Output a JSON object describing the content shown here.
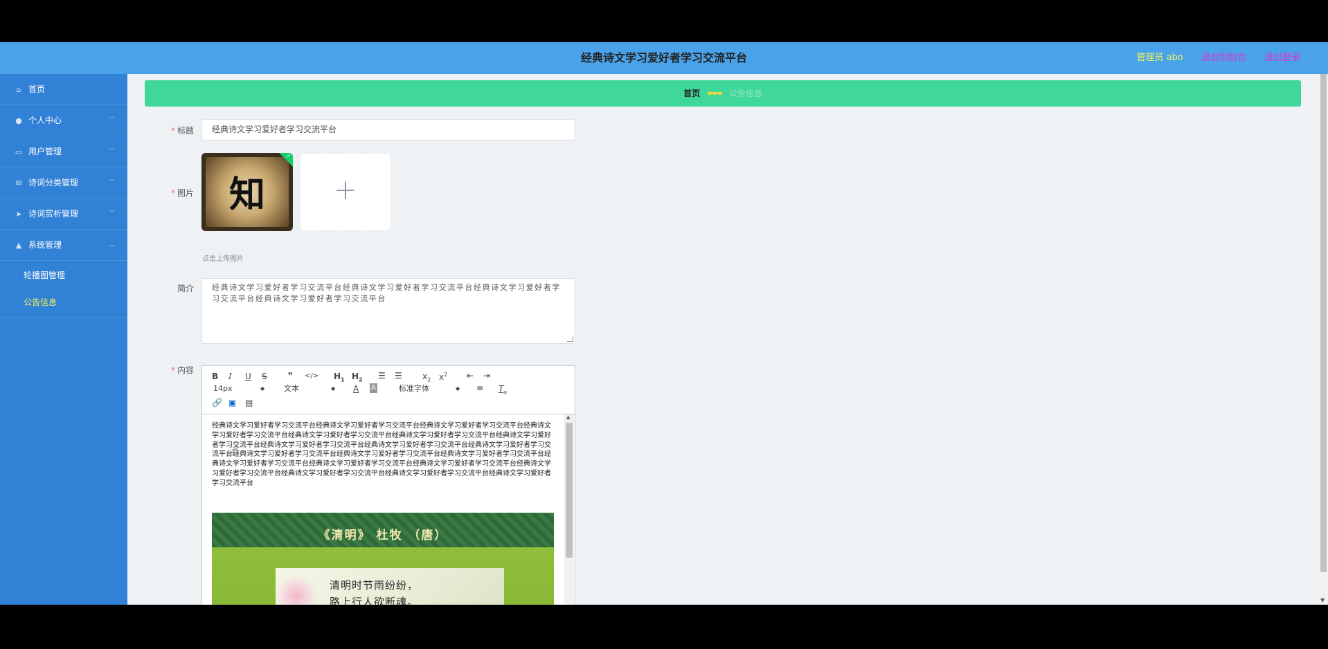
{
  "header": {
    "site_title": "经典诗文学习爱好者学习交流平台",
    "user_label": "管理员 abo",
    "back_to_front": "退出到前台",
    "logout": "退出登录"
  },
  "sidebar": {
    "items": [
      {
        "label": "首页",
        "icon": "home-icon"
      },
      {
        "label": "个人中心",
        "icon": "user-icon"
      },
      {
        "label": "用户管理",
        "icon": "id-card-icon"
      },
      {
        "label": "诗词分类管理",
        "icon": "mail-icon"
      },
      {
        "label": "诗词赏析管理",
        "icon": "send-icon"
      },
      {
        "label": "系统管理",
        "icon": "thumb-up-icon"
      }
    ],
    "sub_items": [
      {
        "label": "轮播图管理",
        "active": false
      },
      {
        "label": "公告信息",
        "active": true
      }
    ]
  },
  "breadcrumb": {
    "home": "首页",
    "separator": "❤❤❤",
    "current": "公告信息"
  },
  "form": {
    "title_label": "标题",
    "title_value": "经典诗文学习爱好者学习交流平台",
    "image_label": "图片",
    "image_char": "知",
    "upload_tip": "点击上传图片",
    "intro_label": "简介",
    "intro_value": "经典诗文学习爱好者学习交流平台经典诗文学习爱好者学习交流平台经典诗文学习爱好者学习交流平台经典诗文学习爱好者学习交流平台",
    "content_label": "内容"
  },
  "editor": {
    "font_size": "14px",
    "header_select": "文本",
    "font_family": "标准字体",
    "body_text": "经典诗文学习爱好者学习交流平台经典诗文学习爱好者学习交流平台经典诗文学习爱好者学习交流平台经典诗文学习爱好者学习交流平台经典诗文学习爱好者学习交流平台经典诗文学习爱好者学习交流平台经典诗文学习爱好者学习交流平台经典诗文学习爱好者学习交流平台经典诗文学习爱好者学习交流平台经典诗文学习爱好者学习交流平台经典诗文学习爱好者学习交流平台经典诗文学习爱好者学习交流平台经典诗文学习爱好者学习交流平台经典诗文学习爱好者学习交流平台经典诗文学习爱好者学习交流平台经典诗文学习爱好者学习交流平台经典诗文学习爱好者学习交流平台经典诗文学习爱好者学习交流平台经典诗文学习爱好者学习交流平台经典诗文学习爱好者学习交流平台",
    "poem_title": "《清明》  杜牧  （唐）",
    "poem_line1": "清明时节雨纷纷，",
    "poem_line2": "路上行人欲断魂。"
  },
  "colors": {
    "header_bg": "#4aa3ea",
    "sidebar_bg": "#3181d7",
    "breadcrumb_bg": "#40d79a",
    "active_text": "#f3f25a",
    "logout_text": "#d838c8"
  }
}
